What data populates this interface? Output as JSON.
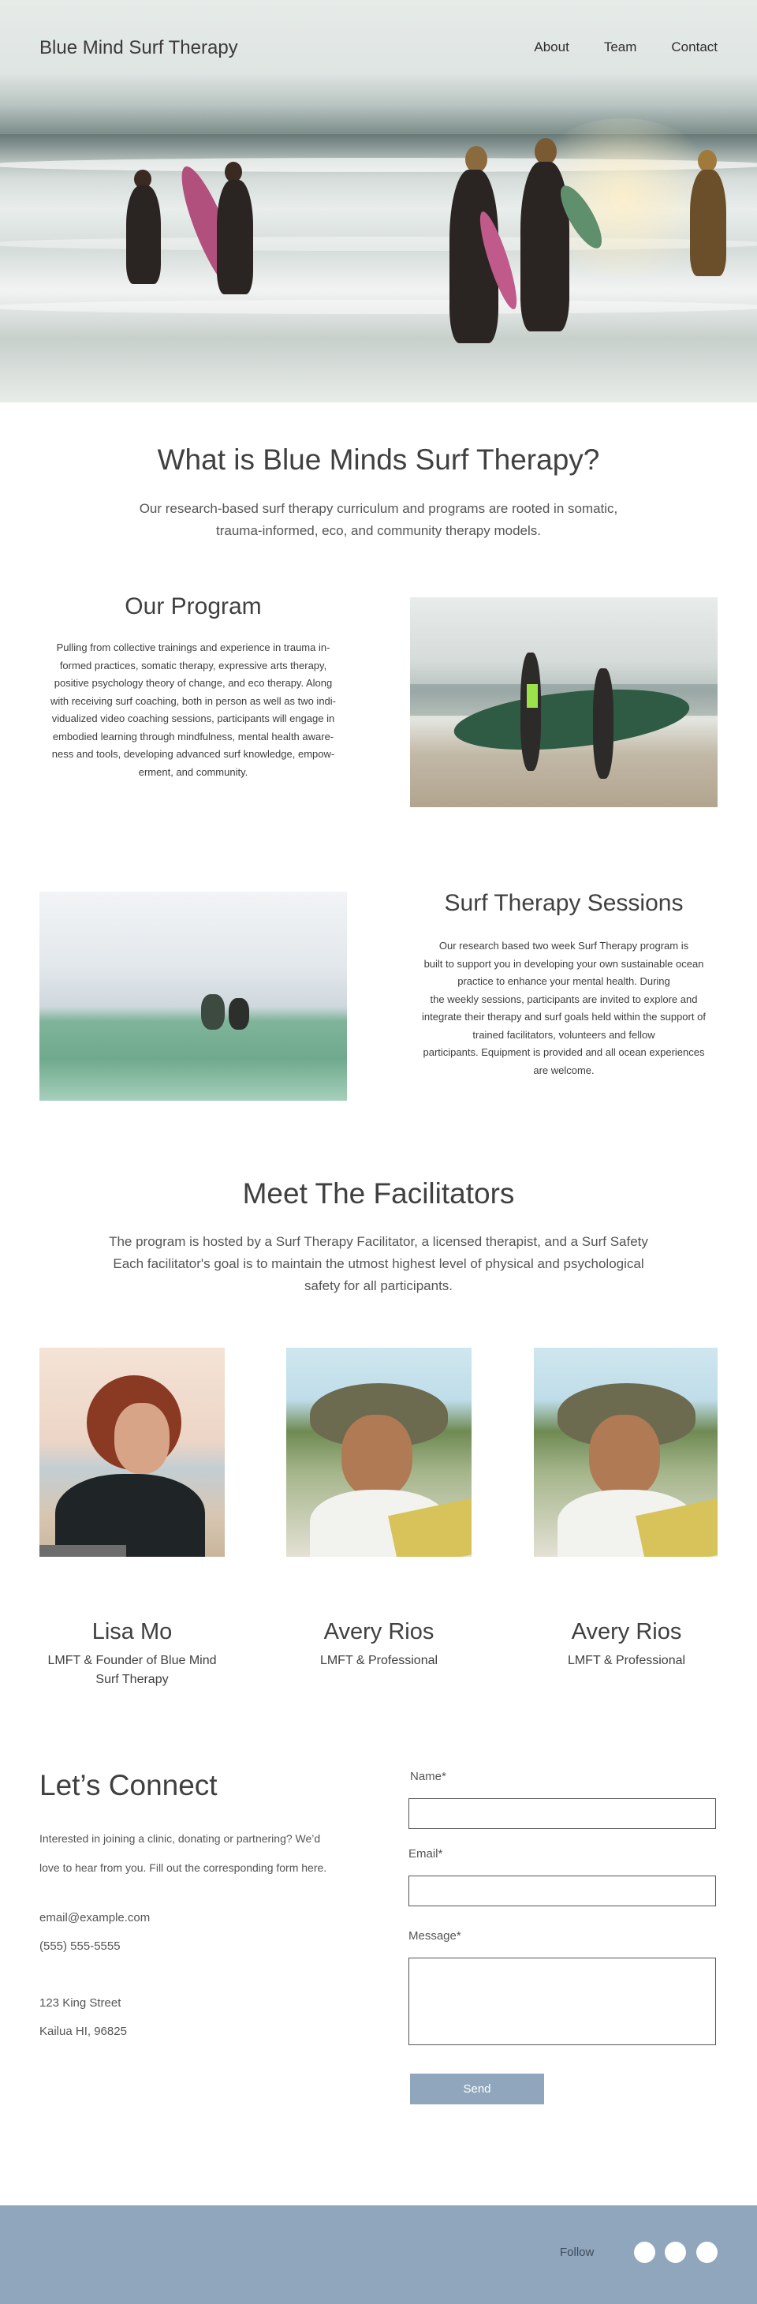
{
  "header": {
    "logo": "Blue Mind Surf Therapy",
    "nav": [
      "About",
      "Team",
      "Contact"
    ]
  },
  "intro": {
    "title": "What is Blue Minds Surf Therapy?",
    "text_line1": "Our research-based surf therapy curriculum and programs are rooted in somatic,",
    "text_line2": "trauma-informed, eco, and community therapy models."
  },
  "program": {
    "title": "Our Program",
    "lines": [
      "Pulling from collective trainings and experience in trauma in-",
      "formed practices, somatic therapy, expressive arts therapy,",
      "positive psychology theory of change, and eco therapy. Along",
      "with receiving surf coaching, both in person as well as two indi-",
      "vidualized video coaching sessions, participants will engage in",
      "embodied learning through mindfulness, mental health aware-",
      "ness and tools, developing advanced surf knowledge, empow-",
      "erment, and community."
    ]
  },
  "sessions": {
    "title": "Surf Therapy Sessions",
    "lines": [
      "Our research based two week Surf Therapy program is",
      "built to support you in developing your own sustainable ocean",
      "practice to enhance your mental health. During",
      "the weekly sessions, participants are invited to explore and",
      "integrate their therapy and surf goals held within the support of",
      "trained facilitators, volunteers and fellow",
      "participants. Equipment is provided and all ocean experiences",
      "are welcome."
    ]
  },
  "facilitators": {
    "title": "Meet The Facilitators",
    "lines": [
      "The program is hosted by a Surf Therapy Facilitator, a licensed therapist, and a Surf Safety",
      "Each facilitator's goal is to maintain the utmost highest level of physical and psychological",
      "safety for all participants."
    ],
    "people": [
      {
        "name": "Lisa Mo",
        "role_line1": "LMFT & Founder of Blue Mind",
        "role_line2": "Surf Therapy"
      },
      {
        "name": "Avery Rios",
        "role_line1": "LMFT & Professional",
        "role_line2": ""
      },
      {
        "name": "Avery Rios",
        "role_line1": "LMFT & Professional",
        "role_line2": ""
      }
    ]
  },
  "connect": {
    "title": "Let’s Connect",
    "text_line1": "Interested in joining a clinic, donating or partnering? We’d",
    "text_line2": "love to hear from you. Fill out the corresponding form here.",
    "email": "email@example.com",
    "phone": "(555) 555-5555",
    "address_line1": "123 King Street",
    "address_line2": "Kailua  HI, 96825"
  },
  "form": {
    "name_label": "Name*",
    "email_label": "Email*",
    "message_label": "Message*",
    "send_label": "Send"
  },
  "footer": {
    "follow_label": "Follow",
    "social_icons": [
      "social-icon-1",
      "social-icon-2",
      "social-icon-3"
    ]
  },
  "colors": {
    "accent": "#8fa6bd",
    "text": "#404040"
  }
}
